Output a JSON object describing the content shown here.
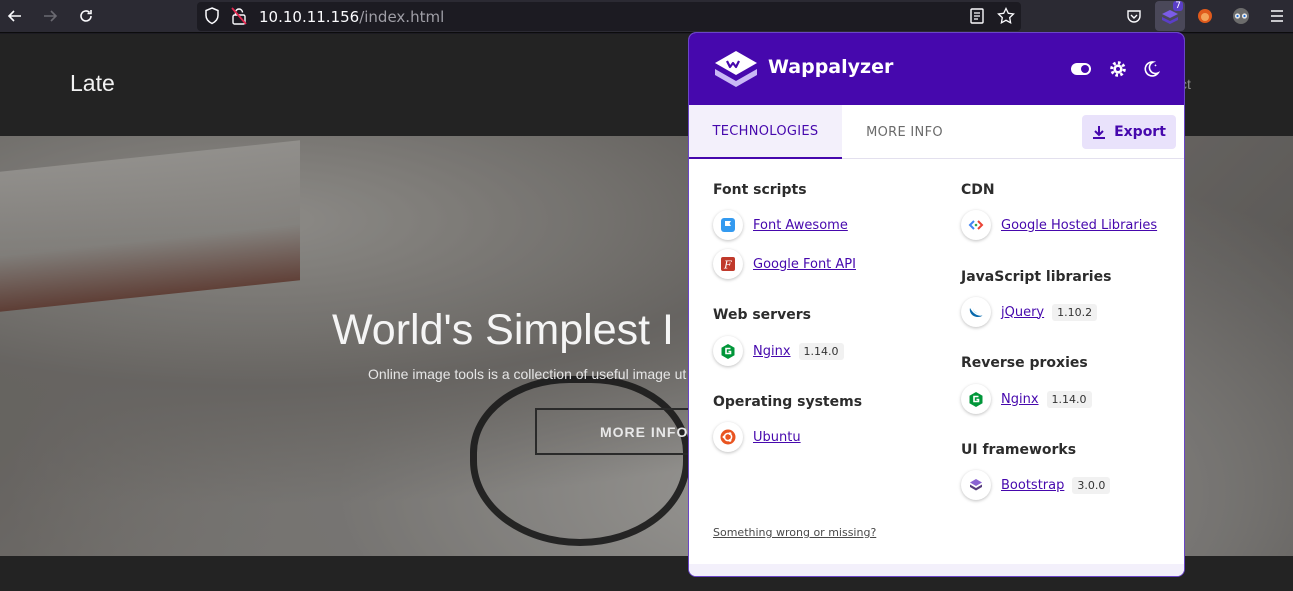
{
  "browser": {
    "url_host": "10.10.11.156",
    "url_path": "/index.html",
    "extension_badge_count": "7"
  },
  "site": {
    "logo": "Late",
    "nav_fragment": "ct",
    "hero_title": "World's Simplest I",
    "hero_subtitle": "Online image tools is a collection of useful image ut",
    "hero_button": "MORE INFO"
  },
  "wappalyzer": {
    "brand": "Wappalyzer",
    "tabs": [
      {
        "label": "TECHNOLOGIES",
        "active": true
      },
      {
        "label": "MORE INFO",
        "active": false
      }
    ],
    "export_label": "Export",
    "left_column": [
      {
        "category": "Font scripts",
        "items": [
          {
            "name": "Font Awesome",
            "version": "",
            "icon": "font-awesome-icon"
          },
          {
            "name": "Google Font API",
            "version": "",
            "icon": "google-font-api-icon"
          }
        ]
      },
      {
        "category": "Web servers",
        "items": [
          {
            "name": "Nginx",
            "version": "1.14.0",
            "icon": "nginx-icon"
          }
        ]
      },
      {
        "category": "Operating systems",
        "items": [
          {
            "name": "Ubuntu",
            "version": "",
            "icon": "ubuntu-icon"
          }
        ]
      }
    ],
    "right_column": [
      {
        "category": "CDN",
        "items": [
          {
            "name": "Google Hosted Libraries",
            "version": "",
            "icon": "google-hosted-libraries-icon"
          }
        ]
      },
      {
        "category": "JavaScript libraries",
        "items": [
          {
            "name": "jQuery",
            "version": "1.10.2",
            "icon": "jquery-icon"
          }
        ]
      },
      {
        "category": "Reverse proxies",
        "items": [
          {
            "name": "Nginx",
            "version": "1.14.0",
            "icon": "nginx-icon"
          }
        ]
      },
      {
        "category": "UI frameworks",
        "items": [
          {
            "name": "Bootstrap",
            "version": "3.0.0",
            "icon": "bootstrap-icon"
          }
        ]
      }
    ],
    "feedback_link": "Something wrong or missing?",
    "colors": {
      "header": "#4608ad",
      "accent": "#4608ad"
    }
  }
}
